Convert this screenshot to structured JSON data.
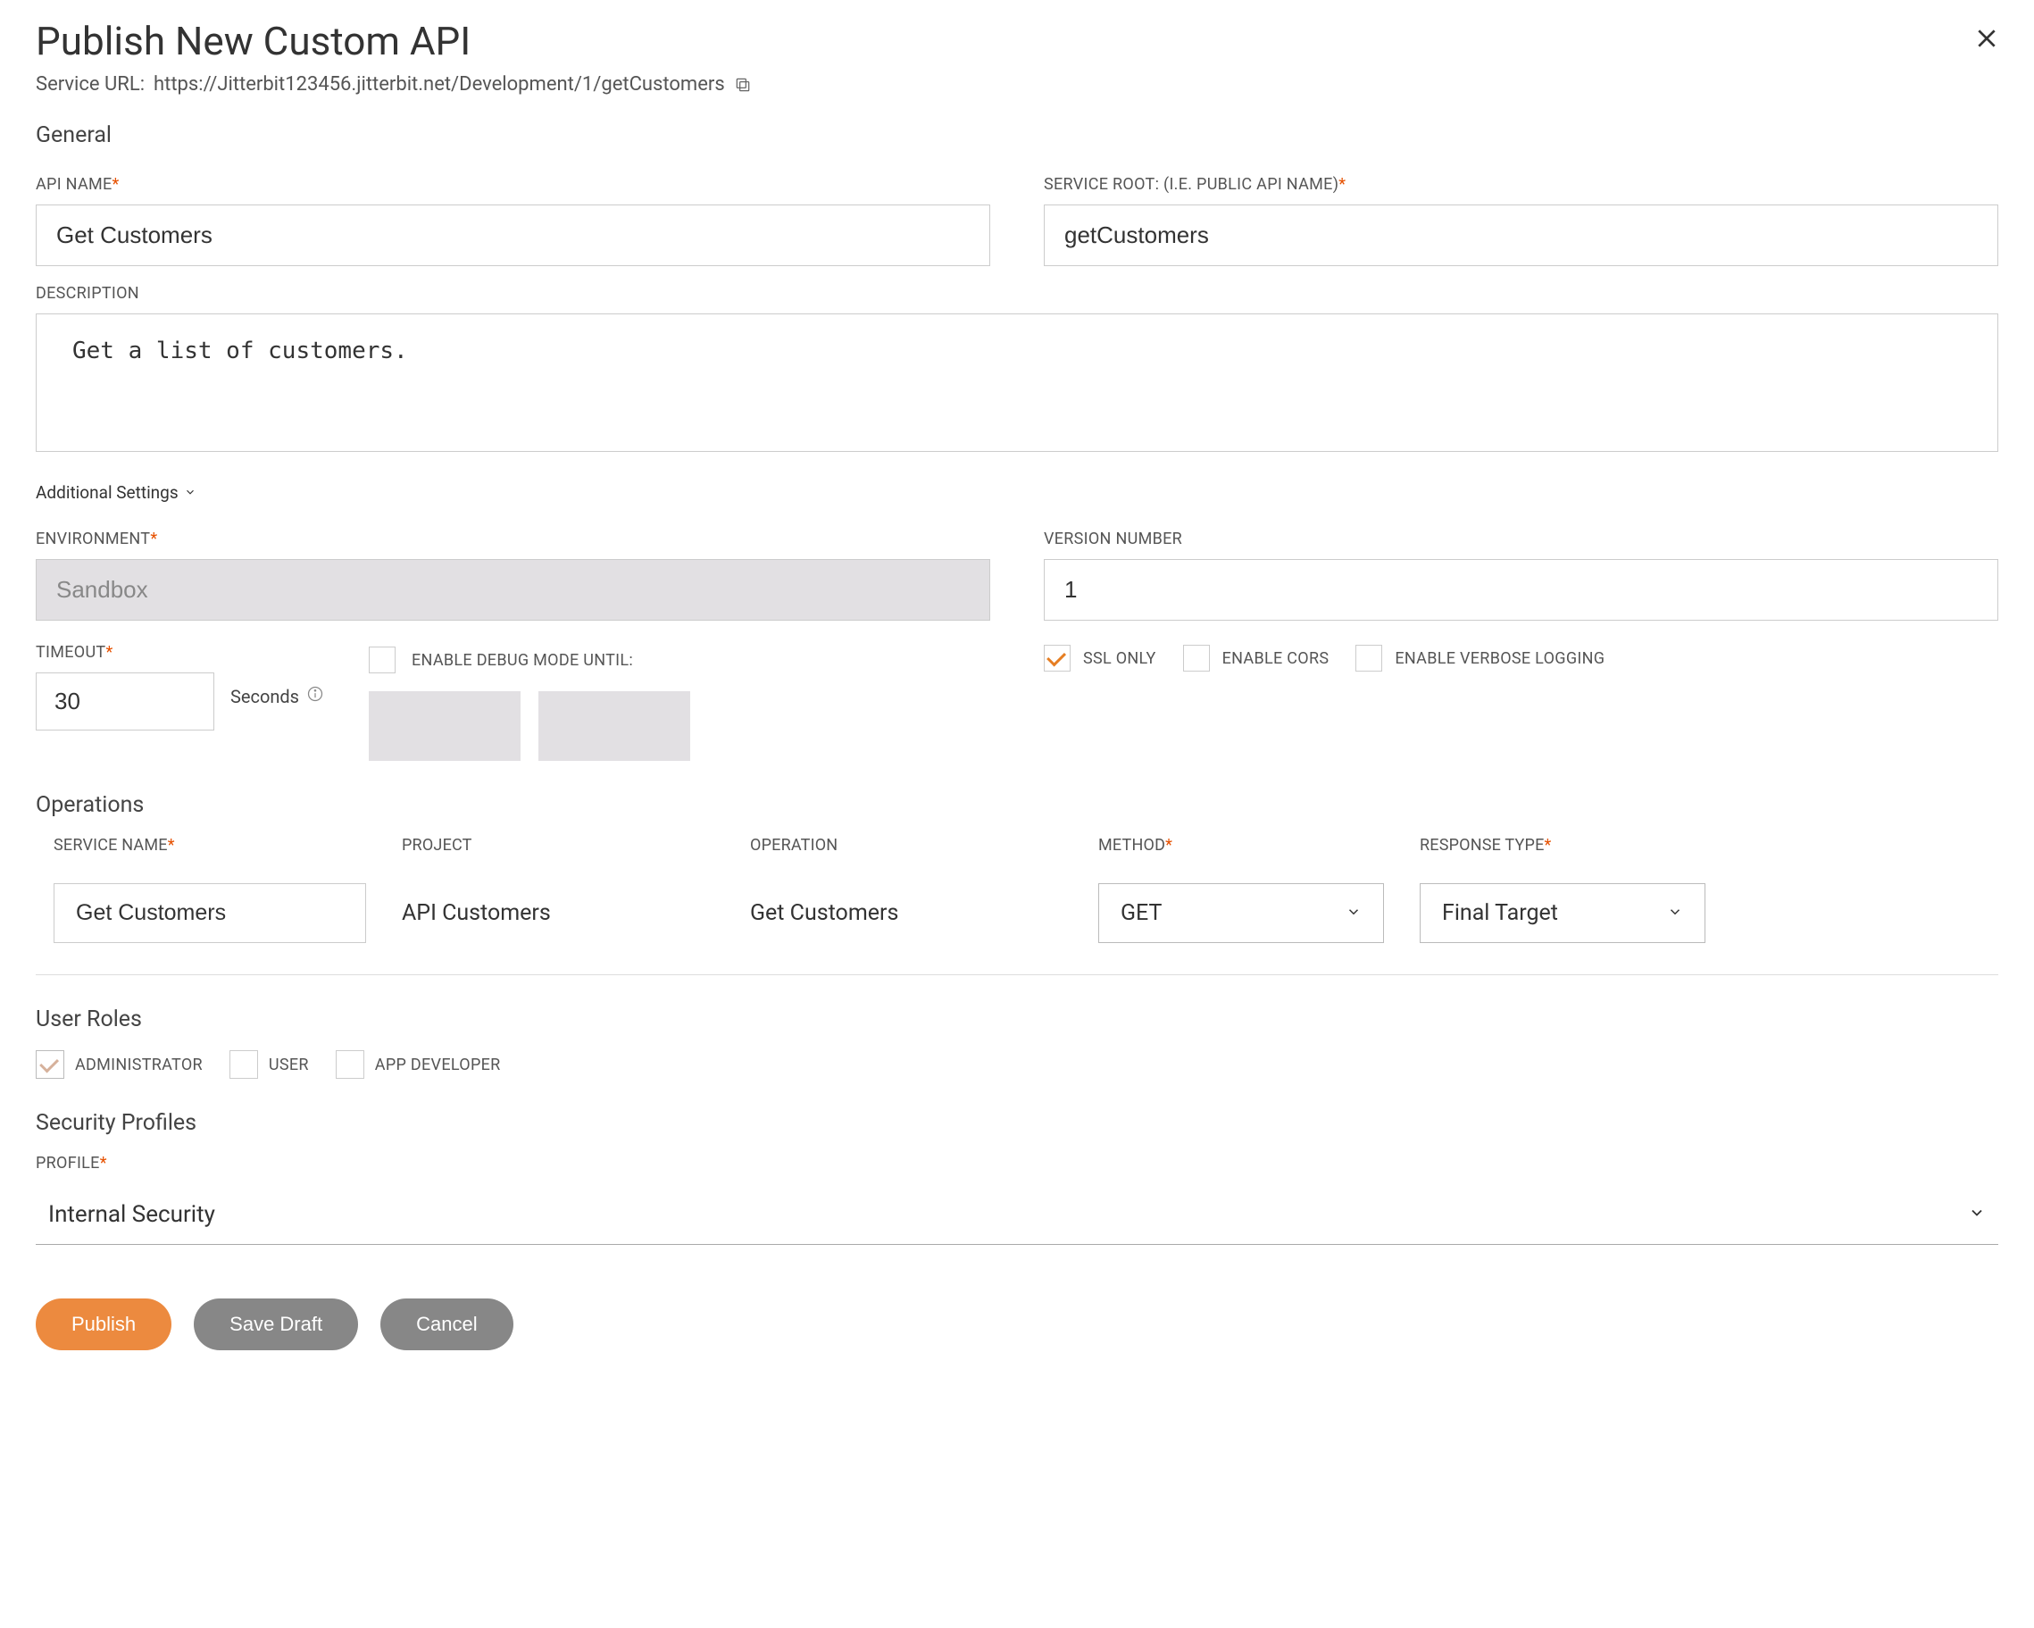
{
  "header": {
    "title": "Publish New Custom API",
    "serviceUrlLabel": "Service URL:",
    "serviceUrl": "https://Jitterbit123456.jitterbit.net/Development/1/getCustomers"
  },
  "general": {
    "heading": "General",
    "apiNameLabel": "API NAME",
    "apiName": "Get Customers",
    "serviceRootLabel": "SERVICE ROOT: (I.E. PUBLIC API NAME)",
    "serviceRoot": "getCustomers",
    "descriptionLabel": "DESCRIPTION",
    "description": "Get a list of customers."
  },
  "additional": {
    "toggleLabel": "Additional Settings",
    "environmentLabel": "ENVIRONMENT",
    "environment": "Sandbox",
    "versionLabel": "VERSION NUMBER",
    "version": "1",
    "timeoutLabel": "TIMEOUT",
    "timeout": "30",
    "secondsLabel": "Seconds",
    "debugLabel": "ENABLE DEBUG MODE UNTIL:",
    "debugChecked": false,
    "sslLabel": "SSL ONLY",
    "sslChecked": true,
    "corsLabel": "ENABLE CORS",
    "corsChecked": false,
    "verboseLabel": "ENABLE VERBOSE LOGGING",
    "verboseChecked": false
  },
  "operations": {
    "heading": "Operations",
    "headers": {
      "serviceName": "SERVICE NAME",
      "project": "PROJECT",
      "operation": "OPERATION",
      "method": "METHOD",
      "responseType": "RESPONSE TYPE"
    },
    "row": {
      "serviceName": "Get Customers",
      "project": "API Customers",
      "operation": "Get Customers",
      "method": "GET",
      "responseType": "Final Target"
    }
  },
  "userRoles": {
    "heading": "User Roles",
    "administratorLabel": "ADMINISTRATOR",
    "administratorChecked": true,
    "userLabel": "USER",
    "userChecked": false,
    "appDeveloperLabel": "APP DEVELOPER",
    "appDeveloperChecked": false
  },
  "securityProfiles": {
    "heading": "Security Profiles",
    "profileLabel": "PROFILE",
    "profile": "Internal Security"
  },
  "actions": {
    "publish": "Publish",
    "saveDraft": "Save Draft",
    "cancel": "Cancel"
  }
}
